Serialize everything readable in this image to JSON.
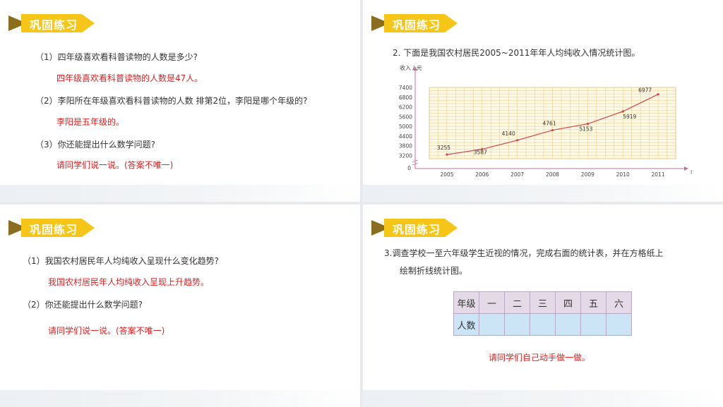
{
  "banner_title": "巩固练习",
  "slide1": {
    "q1": "（1）四年级喜欢看科普读物的人数是多少?",
    "a1": "四年级喜欢看科普读物的人数是47人。",
    "q2": "（2）李阳所在年级喜欢看科普读物的人数 排第2位，李阳是哪个年级的?",
    "a2": "李阳是五年级的。",
    "q3": "（3）你还能提出什么数学问题?",
    "a3": "请同学们说一说。(答案不唯一)"
  },
  "slide2": {
    "question": "2. 下面是我国农村居民2005~2011年年人均纯收入情况统计图。"
  },
  "chart_data": {
    "type": "line",
    "ylabel": "收入 / 元",
    "xlabel": "年份",
    "x": [
      "2005",
      "2006",
      "2007",
      "2008",
      "2009",
      "2010",
      "2011"
    ],
    "values": [
      3255,
      3587,
      4140,
      4761,
      5153,
      5919,
      6977
    ],
    "y_ticks": [
      0,
      3200,
      3800,
      4400,
      5000,
      5600,
      6200,
      6800,
      7400
    ],
    "y_ticks_labels": [
      "0",
      "3200",
      "3800",
      "4400",
      "5000",
      "5600",
      "6200",
      "6800",
      "7400"
    ],
    "ylim": [
      3000,
      7400
    ],
    "grid": true,
    "line_color": "#d0454f",
    "grid_color": "#e7c98a",
    "plot_bg": "#fdf9e4"
  },
  "slide3": {
    "q1": "（1）我国农村居民年人均纯收入呈现什么变化趋势?",
    "a1": "我国农村居民年人均纯收入呈现上升趋势。",
    "q2": "（2）你还能提出什么数学问题?",
    "a2": "请同学们说一说。(答案不唯一)"
  },
  "slide4": {
    "q_line1": "3.调查学校一至六年级学生近视的情况，完成右面的统计表，并在方格纸上",
    "q_line2": "绘制折线统计图。",
    "table": {
      "header": [
        "年级",
        "一",
        "二",
        "三",
        "四",
        "五",
        "六"
      ],
      "row_label": "人数"
    },
    "answer": "请同学们自己动手做一做。"
  },
  "colors": {
    "banner_yellow": "#f5c518",
    "banner_dark": "#8a6d1e",
    "answer_red": "#e02020"
  }
}
